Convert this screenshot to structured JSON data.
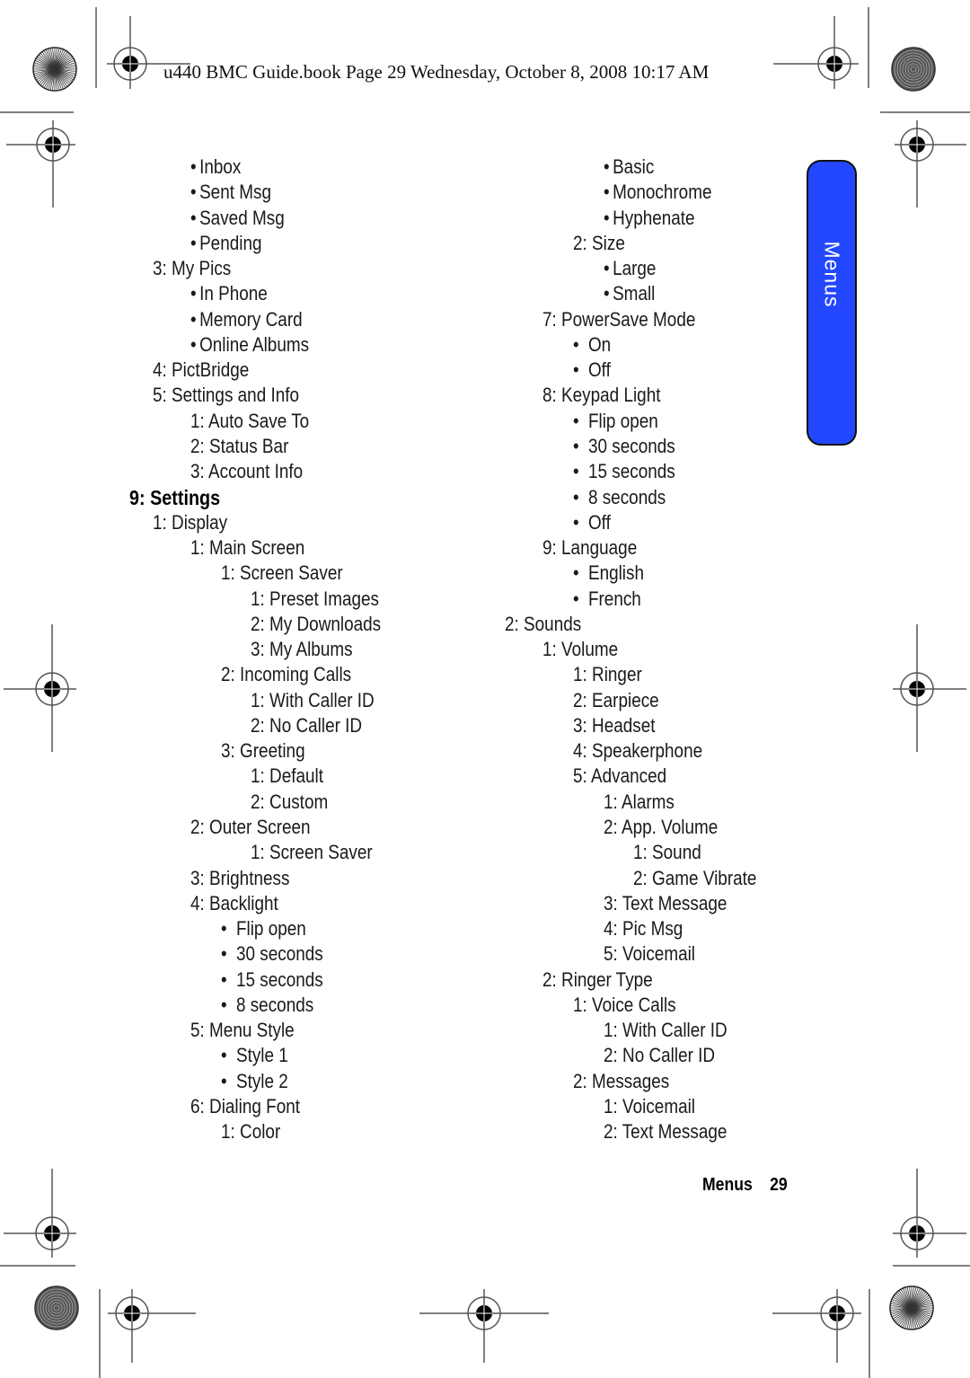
{
  "header": {
    "book_info": "u440 BMC Guide.book  Page 29  Wednesday, October 8, 2008  10:17 AM"
  },
  "side_tab": {
    "label": "Menus",
    "color": "#2347ff"
  },
  "footer": {
    "section": "Menus",
    "page_number": "29"
  },
  "left_column": [
    {
      "text": "Inbox",
      "level": 2,
      "bullet": true
    },
    {
      "text": "Sent Msg",
      "level": 2,
      "bullet": true
    },
    {
      "text": "Saved Msg",
      "level": 2,
      "bullet": true
    },
    {
      "text": "Pending",
      "level": 2,
      "bullet": true
    },
    {
      "text": "3: My Pics",
      "level": 1,
      "bullet": false
    },
    {
      "text": "In Phone",
      "level": 2,
      "bullet": true
    },
    {
      "text": "Memory Card",
      "level": 2,
      "bullet": true
    },
    {
      "text": "Online Albums",
      "level": 2,
      "bullet": true
    },
    {
      "text": "4: PictBridge",
      "level": 1,
      "bullet": false
    },
    {
      "text": "5: Settings and Info",
      "level": 1,
      "bullet": false
    },
    {
      "text": "1: Auto Save To",
      "level": 2,
      "bullet": false
    },
    {
      "text": "2: Status Bar",
      "level": 2,
      "bullet": false
    },
    {
      "text": "3: Account Info",
      "level": 2,
      "bullet": false
    },
    {
      "text": "9: Settings",
      "level": 0,
      "bullet": false,
      "bold": true
    },
    {
      "text": "1: Display",
      "level": 1,
      "bullet": false
    },
    {
      "text": "1: Main Screen",
      "level": 2,
      "bullet": false
    },
    {
      "text": "1: Screen Saver",
      "level": 3,
      "bullet": false
    },
    {
      "text": "1: Preset Images",
      "level": 4,
      "bullet": false
    },
    {
      "text": "2: My Downloads",
      "level": 4,
      "bullet": false
    },
    {
      "text": "3: My Albums",
      "level": 4,
      "bullet": false
    },
    {
      "text": "2: Incoming Calls",
      "level": 3,
      "bullet": false
    },
    {
      "text": "1: With Caller ID",
      "level": 4,
      "bullet": false
    },
    {
      "text": "2: No Caller ID",
      "level": 4,
      "bullet": false
    },
    {
      "text": "3: Greeting",
      "level": 3,
      "bullet": false
    },
    {
      "text": "1: Default",
      "level": 4,
      "bullet": false
    },
    {
      "text": "2: Custom",
      "level": 4,
      "bullet": false
    },
    {
      "text": "2: Outer Screen",
      "level": 2,
      "bullet": false
    },
    {
      "text": "1: Screen Saver",
      "level": 4,
      "bullet": false
    },
    {
      "text": "3: Brightness",
      "level": 2,
      "bullet": false
    },
    {
      "text": "4: Backlight",
      "level": 2,
      "bullet": false
    },
    {
      "text": "Flip open",
      "level": 3,
      "bullet": true,
      "wide": true
    },
    {
      "text": "30 seconds",
      "level": 3,
      "bullet": true,
      "wide": true
    },
    {
      "text": "15 seconds",
      "level": 3,
      "bullet": true,
      "wide": true
    },
    {
      "text": "8 seconds",
      "level": 3,
      "bullet": true,
      "wide": true
    },
    {
      "text": "5: Menu Style",
      "level": 2,
      "bullet": false
    },
    {
      "text": "Style 1",
      "level": 3,
      "bullet": true,
      "wide": true
    },
    {
      "text": "Style 2",
      "level": 3,
      "bullet": true,
      "wide": true
    },
    {
      "text": "6: Dialing Font",
      "level": 2,
      "bullet": false
    },
    {
      "text": "1: Color",
      "level": 3,
      "bullet": false
    }
  ],
  "right_column": [
    {
      "text": "Basic",
      "level": 4,
      "bullet": true
    },
    {
      "text": "Monochrome",
      "level": 4,
      "bullet": true
    },
    {
      "text": "Hyphenate",
      "level": 4,
      "bullet": true
    },
    {
      "text": "2: Size",
      "level": 3,
      "bullet": false
    },
    {
      "text": "Large",
      "level": 4,
      "bullet": true
    },
    {
      "text": "Small",
      "level": 4,
      "bullet": true
    },
    {
      "text": "7: PowerSave Mode",
      "level": 2,
      "bullet": false
    },
    {
      "text": "On",
      "level": 3,
      "bullet": true,
      "wide": true
    },
    {
      "text": "Off",
      "level": 3,
      "bullet": true,
      "wide": true
    },
    {
      "text": "8: Keypad Light",
      "level": 2,
      "bullet": false
    },
    {
      "text": "Flip open",
      "level": 3,
      "bullet": true,
      "wide": true
    },
    {
      "text": "30 seconds",
      "level": 3,
      "bullet": true,
      "wide": true
    },
    {
      "text": "15 seconds",
      "level": 3,
      "bullet": true,
      "wide": true
    },
    {
      "text": "8 seconds",
      "level": 3,
      "bullet": true,
      "wide": true
    },
    {
      "text": "Off",
      "level": 3,
      "bullet": true,
      "wide": true
    },
    {
      "text": "9: Language",
      "level": 2,
      "bullet": false
    },
    {
      "text": "English",
      "level": 3,
      "bullet": true,
      "wide": true
    },
    {
      "text": "French",
      "level": 3,
      "bullet": true,
      "wide": true
    },
    {
      "text": "2: Sounds",
      "level": 1,
      "bullet": false
    },
    {
      "text": "1: Volume",
      "level": 2,
      "bullet": false
    },
    {
      "text": "1: Ringer",
      "level": 3,
      "bullet": false
    },
    {
      "text": "2: Earpiece",
      "level": 3,
      "bullet": false
    },
    {
      "text": "3: Headset",
      "level": 3,
      "bullet": false
    },
    {
      "text": "4: Speakerphone",
      "level": 3,
      "bullet": false
    },
    {
      "text": "5: Advanced",
      "level": 3,
      "bullet": false
    },
    {
      "text": "1: Alarms",
      "level": 4,
      "bullet": false
    },
    {
      "text": "2: App. Volume",
      "level": 4,
      "bullet": false
    },
    {
      "text": "1: Sound",
      "level": 5,
      "bullet": false
    },
    {
      "text": "2: Game Vibrate",
      "level": 5,
      "bullet": false
    },
    {
      "text": "3: Text Message",
      "level": 4,
      "bullet": false
    },
    {
      "text": "4: Pic Msg",
      "level": 4,
      "bullet": false
    },
    {
      "text": "5: Voicemail",
      "level": 4,
      "bullet": false
    },
    {
      "text": "2: Ringer Type",
      "level": 2,
      "bullet": false
    },
    {
      "text": "1: Voice Calls",
      "level": 3,
      "bullet": false
    },
    {
      "text": "1: With Caller ID",
      "level": 4,
      "bullet": false
    },
    {
      "text": "2: No Caller ID",
      "level": 4,
      "bullet": false
    },
    {
      "text": "2: Messages",
      "level": 3,
      "bullet": false
    },
    {
      "text": "1: Voicemail",
      "level": 4,
      "bullet": false
    },
    {
      "text": "2: Text Message",
      "level": 4,
      "bullet": false
    }
  ]
}
